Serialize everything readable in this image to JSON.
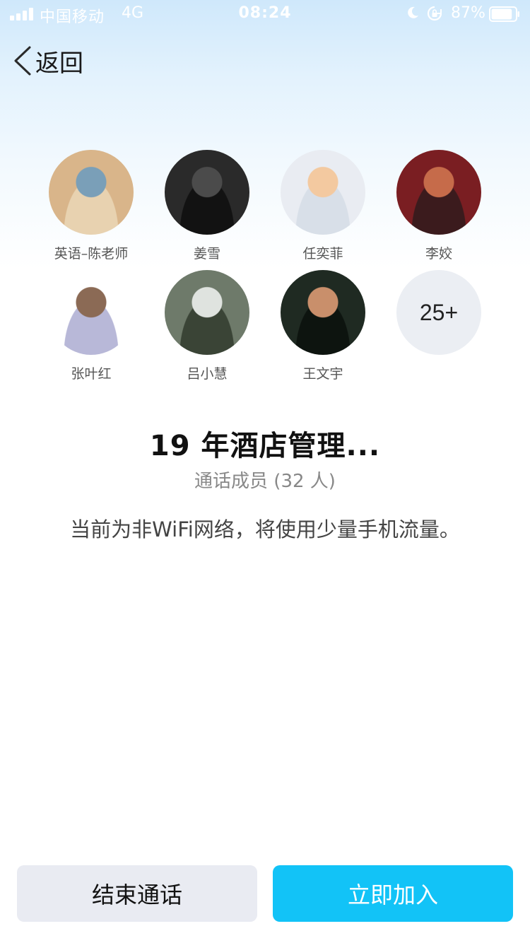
{
  "status_bar": {
    "carrier": "中国移动",
    "network": "4G",
    "time": "08:24",
    "battery": "87%",
    "battery_level": 0.87
  },
  "nav": {
    "back_label": "返回"
  },
  "members": [
    {
      "name": "英语–陈老师",
      "avatar_colors": [
        "#d9b58a",
        "#7a9fb8",
        "#e8d2b0"
      ]
    },
    {
      "name": "姜雪",
      "avatar_colors": [
        "#2a2a2a",
        "#4b4b4b",
        "#121212"
      ]
    },
    {
      "name": "任奕菲",
      "avatar_colors": [
        "#e9ecf2",
        "#f3c9a0",
        "#d8dfe8"
      ]
    },
    {
      "name": "李姣",
      "avatar_colors": [
        "#7a1e22",
        "#c66b4a",
        "#3b1b1d"
      ]
    },
    {
      "name": "张叶红",
      "avatar_colors": [
        "#ffffff",
        "#8b6a55",
        "#b8b8d8"
      ]
    },
    {
      "name": "吕小慧",
      "avatar_colors": [
        "#6e7a6a",
        "#dfe3df",
        "#3a4436"
      ]
    },
    {
      "name": "王文宇",
      "avatar_colors": [
        "#1f2a22",
        "#c98f6b",
        "#0d140f"
      ]
    }
  ],
  "more_badge": "25+",
  "group_title": "19 年酒店管理...",
  "member_count": "通话成员 (32 人)",
  "network_note": "当前为非WiFi网络，将使用少量手机流量。",
  "actions": {
    "end_label": "结束通话",
    "join_label": "立即加入"
  },
  "colors": {
    "join_button": "#12c3f7",
    "end_button": "#e9ebf2",
    "more_badge_bg": "#ebeef3"
  }
}
